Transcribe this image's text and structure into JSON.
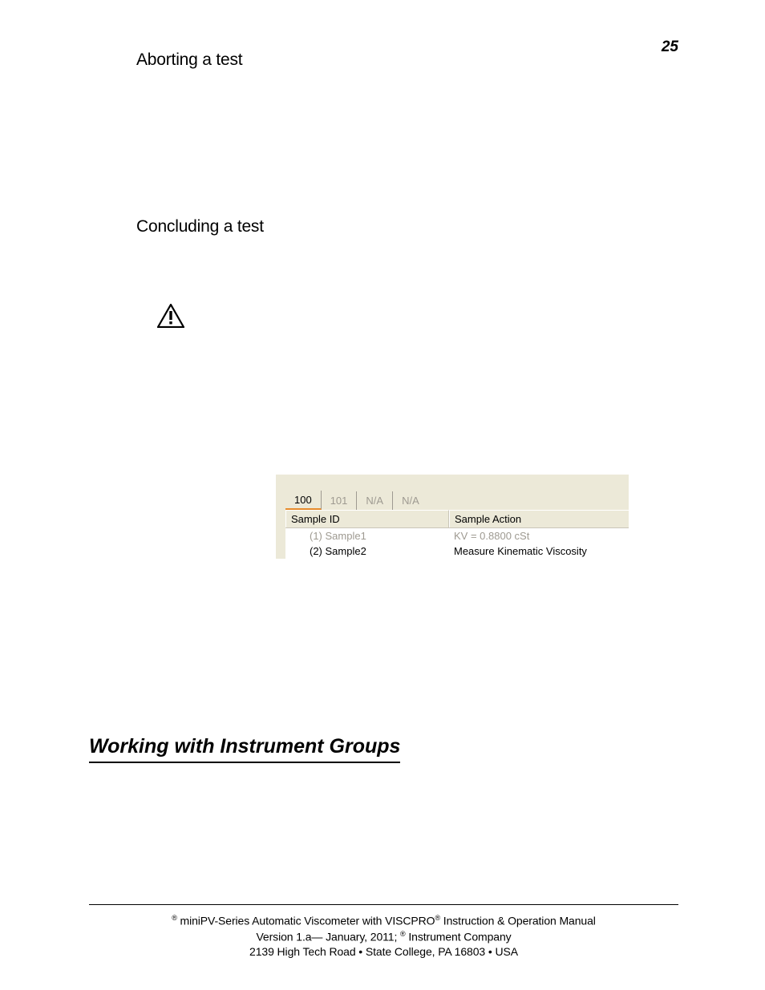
{
  "page_number": "25",
  "headings": {
    "aborting": "Aborting a test",
    "concluding": "Concluding a test",
    "section": "Working with Instrument Groups"
  },
  "ui": {
    "tabs": [
      "100",
      "101",
      "N/A",
      "N/A"
    ],
    "columns": {
      "id": "Sample ID",
      "action": "Sample Action"
    },
    "rows": [
      {
        "id": "(1)  Sample1",
        "action": "KV =  0.8800 cSt"
      },
      {
        "id": "(2)  Sample2",
        "action": "Measure Kinematic Viscosity"
      }
    ]
  },
  "footer": {
    "line1_pre": " miniPV-Series Automatic Viscometer with VISCPRO",
    "line1_post": " Instruction & Operation Manual",
    "line2_pre": "Version 1.a— January, 2011; ",
    "line2_post": " Instrument Company",
    "line3": "2139 High Tech Road • State College, PA  16803 • USA",
    "reg": "®"
  }
}
